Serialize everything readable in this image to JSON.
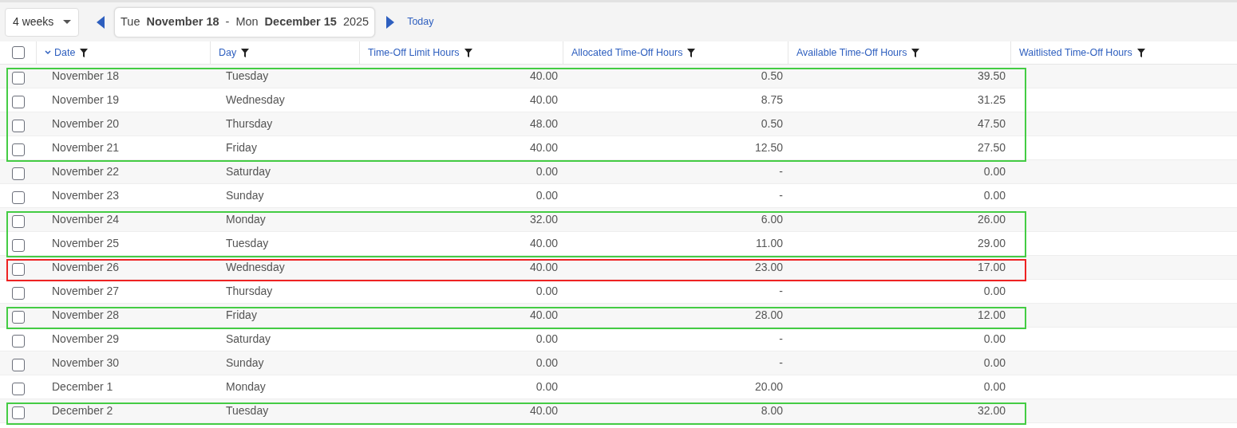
{
  "toolbar": {
    "range_select": "4 weeks",
    "date_range": {
      "start_weekday": "Tue",
      "start_date": "November 18",
      "separator": "-",
      "end_weekday": "Mon",
      "end_date": "December 15",
      "year": "2025"
    },
    "today_link": "Today"
  },
  "table": {
    "select_all_checked": false,
    "columns": [
      {
        "label": "Date",
        "sorted": true,
        "kind": "text"
      },
      {
        "label": "Day",
        "sorted": false,
        "kind": "text"
      },
      {
        "label": "Time-Off Limit Hours",
        "sorted": false,
        "kind": "number"
      },
      {
        "label": "Allocated Time-Off Hours",
        "sorted": false,
        "kind": "number"
      },
      {
        "label": "Available Time-Off Hours",
        "sorted": false,
        "kind": "number"
      },
      {
        "label": "Waitlisted Time-Off Hours",
        "sorted": false,
        "kind": "number"
      }
    ],
    "rows": [
      {
        "checked": false,
        "color": "#44cc44",
        "cells": [
          "November 18",
          "Tuesday",
          "40.00",
          "0.50",
          "39.50"
        ]
      },
      {
        "checked": false,
        "color": "#44cc44",
        "cells": [
          "November 19",
          "Wednesday",
          "40.00",
          "8.75",
          "31.25"
        ]
      },
      {
        "checked": false,
        "color": "#44cc44",
        "cells": [
          "November 20",
          "Thursday",
          "48.00",
          "0.50",
          "47.50"
        ]
      },
      {
        "checked": false,
        "color": "#44cc44",
        "cells": [
          "November 21",
          "Friday",
          "40.00",
          "12.50",
          "27.50"
        ]
      },
      {
        "checked": false,
        "cells": [
          "November 22",
          "Saturday",
          "0.00",
          "-",
          "0.00"
        ]
      },
      {
        "checked": false,
        "cells": [
          "November 23",
          "Sunday",
          "0.00",
          "-",
          "0.00"
        ]
      },
      {
        "checked": false,
        "color": "#44cc44",
        "cells": [
          "November 24",
          "Monday",
          "32.00",
          "6.00",
          "26.00"
        ]
      },
      {
        "checked": false,
        "color": "#44cc44",
        "cells": [
          "November 25",
          "Tuesday",
          "40.00",
          "11.00",
          "29.00"
        ]
      },
      {
        "checked": false,
        "color": "#ee2222",
        "cells": [
          "November 26",
          "Wednesday",
          "40.00",
          "23.00",
          "17.00"
        ]
      },
      {
        "checked": false,
        "cells": [
          "November 27",
          "Thursday",
          "0.00",
          "-",
          "0.00"
        ]
      },
      {
        "checked": false,
        "color": "#44cc44",
        "cells": [
          "November 28",
          "Friday",
          "40.00",
          "28.00",
          "12.00"
        ]
      },
      {
        "checked": false,
        "cells": [
          "November 29",
          "Saturday",
          "0.00",
          "-",
          "0.00"
        ]
      },
      {
        "checked": false,
        "cells": [
          "November 30",
          "Sunday",
          "0.00",
          "-",
          "0.00"
        ]
      },
      {
        "checked": false,
        "cells": [
          "December 1",
          "Monday",
          "0.00",
          "20.00",
          "0.00"
        ]
      },
      {
        "checked": false,
        "color": "#44cc44",
        "cells": [
          "December 2",
          "Tuesday",
          "40.00",
          "8.00",
          "32.00"
        ]
      }
    ]
  }
}
